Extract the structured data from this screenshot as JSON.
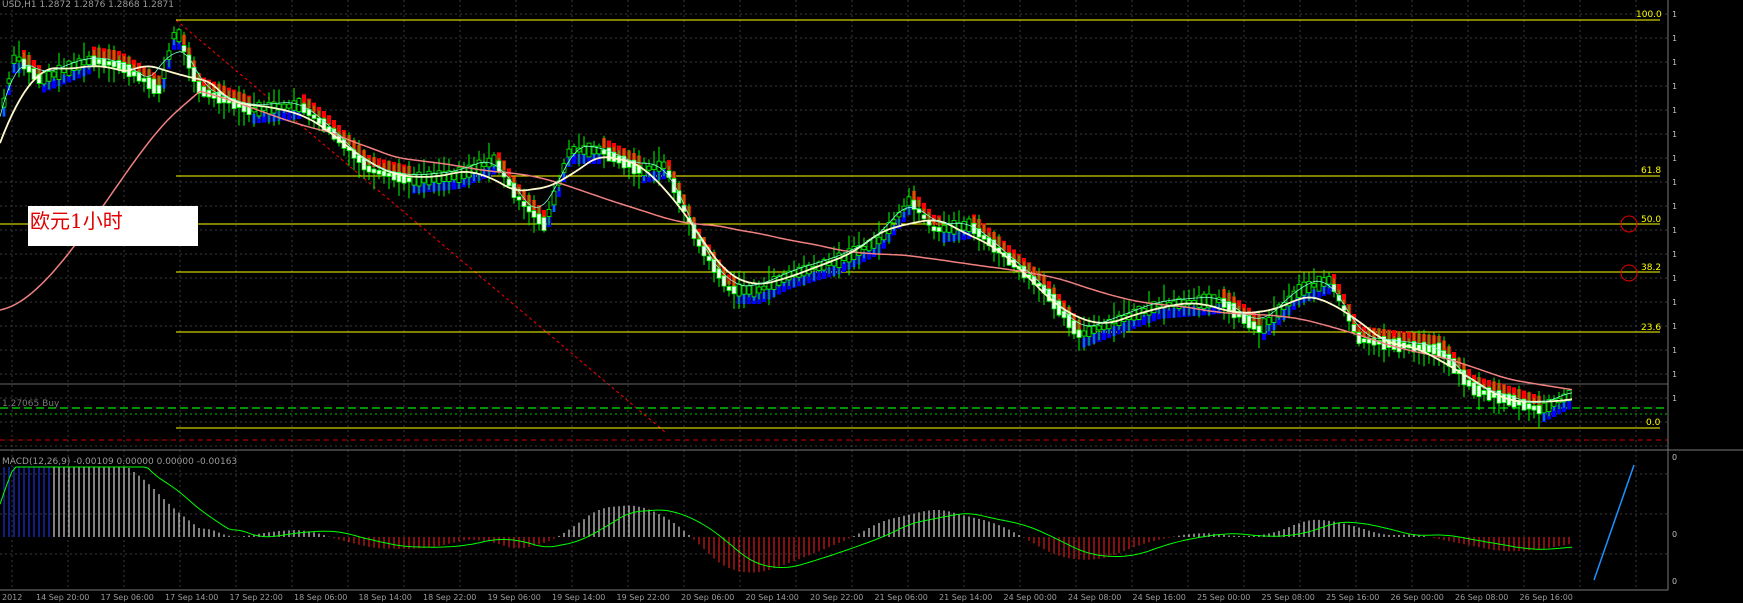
{
  "window": {
    "title": "USD,H1  1.2872 1.2876 1.2868 1.2871",
    "annotation": "欧元1小时"
  },
  "price_axis": {
    "ticks": [
      "1",
      "1",
      "1",
      "1",
      "1",
      "1",
      "1",
      "1",
      "1",
      "1",
      "1",
      "1",
      "1",
      "1",
      "1",
      "1",
      "1"
    ],
    "current_level_label": "1.27065 Buy"
  },
  "fibonacci": {
    "levels": [
      "100.0",
      "61.8",
      "50.0",
      "38.2",
      "23.6",
      "0.0"
    ]
  },
  "macd": {
    "label": "MACD(12,26,9) -0.00109 0.00000 0.00000 -0.00163",
    "axis_ticks": [
      "0",
      "0",
      "0"
    ]
  },
  "time_axis": {
    "labels": [
      "2012",
      "14 Sep 20:00",
      "17 Sep 06:00",
      "17 Sep 14:00",
      "17 Sep 22:00",
      "18 Sep 06:00",
      "18 Sep 14:00",
      "18 Sep 22:00",
      "19 Sep 06:00",
      "19 Sep 14:00",
      "19 Sep 22:00",
      "20 Sep 06:00",
      "20 Sep 14:00",
      "20 Sep 22:00",
      "21 Sep 06:00",
      "21 Sep 14:00",
      "24 Sep 00:00",
      "24 Sep 08:00",
      "24 Sep 16:00",
      "25 Sep 00:00",
      "25 Sep 08:00",
      "25 Sep 16:00",
      "26 Sep 00:00",
      "26 Sep 08:00",
      "26 Sep 16:00"
    ]
  },
  "colors": {
    "background": "#000000",
    "fib_line": "#ffff00",
    "bull_candle": "#00ff00",
    "bear_candle": "#ffffff",
    "heiken_up": "#0000ff",
    "heiken_down": "#ff0000",
    "slow_ma": "#f08080",
    "fast_ma": "#ffffff",
    "macd_signal": "#00ff00"
  }
}
